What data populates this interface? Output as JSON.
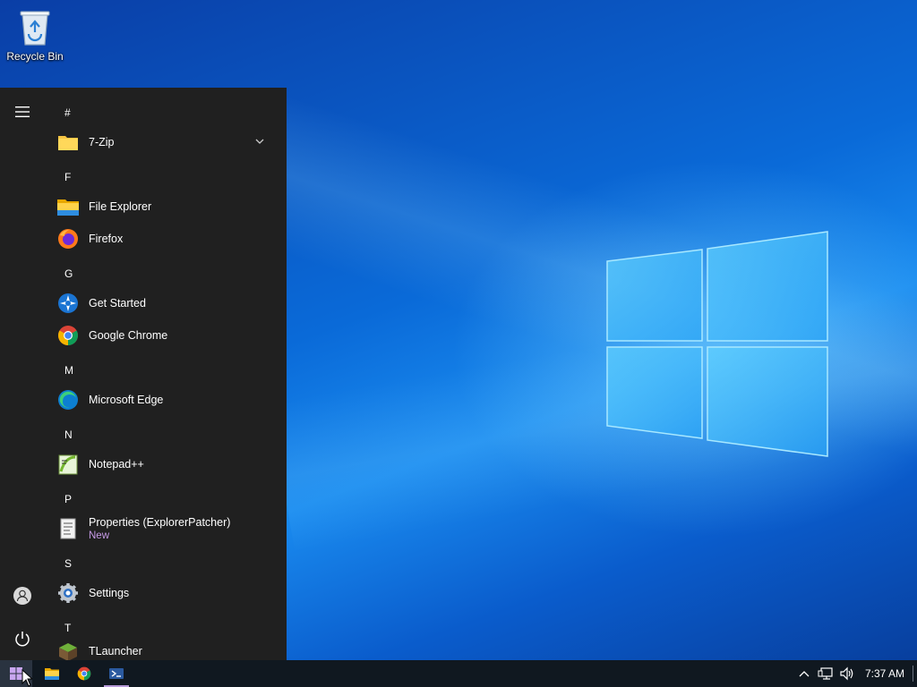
{
  "desktop": {
    "icons": [
      {
        "label": "Recycle Bin",
        "icon": "recycle-bin-icon"
      }
    ]
  },
  "start_menu": {
    "rail": {
      "menu_icon": "hamburger-icon",
      "user_icon": "user-icon",
      "power_icon": "power-icon"
    },
    "groups": [
      {
        "letter": "#",
        "apps": [
          {
            "name": "7-Zip",
            "icon": "folder-icon",
            "expandable": true
          }
        ]
      },
      {
        "letter": "F",
        "apps": [
          {
            "name": "File Explorer",
            "icon": "file-explorer-icon"
          },
          {
            "name": "Firefox",
            "icon": "firefox-icon"
          }
        ]
      },
      {
        "letter": "G",
        "apps": [
          {
            "name": "Get Started",
            "icon": "get-started-icon"
          },
          {
            "name": "Google Chrome",
            "icon": "chrome-icon"
          }
        ]
      },
      {
        "letter": "M",
        "apps": [
          {
            "name": "Microsoft Edge",
            "icon": "edge-icon"
          }
        ]
      },
      {
        "letter": "N",
        "apps": [
          {
            "name": "Notepad++",
            "icon": "notepad-plus-plus-icon"
          }
        ]
      },
      {
        "letter": "P",
        "apps": [
          {
            "name": "Properties (ExplorerPatcher)",
            "sub": "New",
            "icon": "properties-icon"
          }
        ]
      },
      {
        "letter": "S",
        "apps": [
          {
            "name": "Settings",
            "icon": "settings-gear-icon"
          }
        ]
      },
      {
        "letter": "T",
        "apps": [
          {
            "name": "TLauncher",
            "icon": "tlauncher-icon"
          }
        ]
      }
    ]
  },
  "taskbar": {
    "pinned": [
      "windows-start-icon",
      "file-explorer-icon",
      "chrome-icon",
      "powershell-icon"
    ],
    "tray": {
      "icons": [
        "chevron-up-icon",
        "network-icon",
        "volume-icon"
      ],
      "clock": "7:37 AM"
    }
  },
  "colors": {
    "accent": "#b79ad8",
    "start_bg": "#202020",
    "taskbar_bg": "#101820",
    "new_badge": "#c69ae6"
  }
}
